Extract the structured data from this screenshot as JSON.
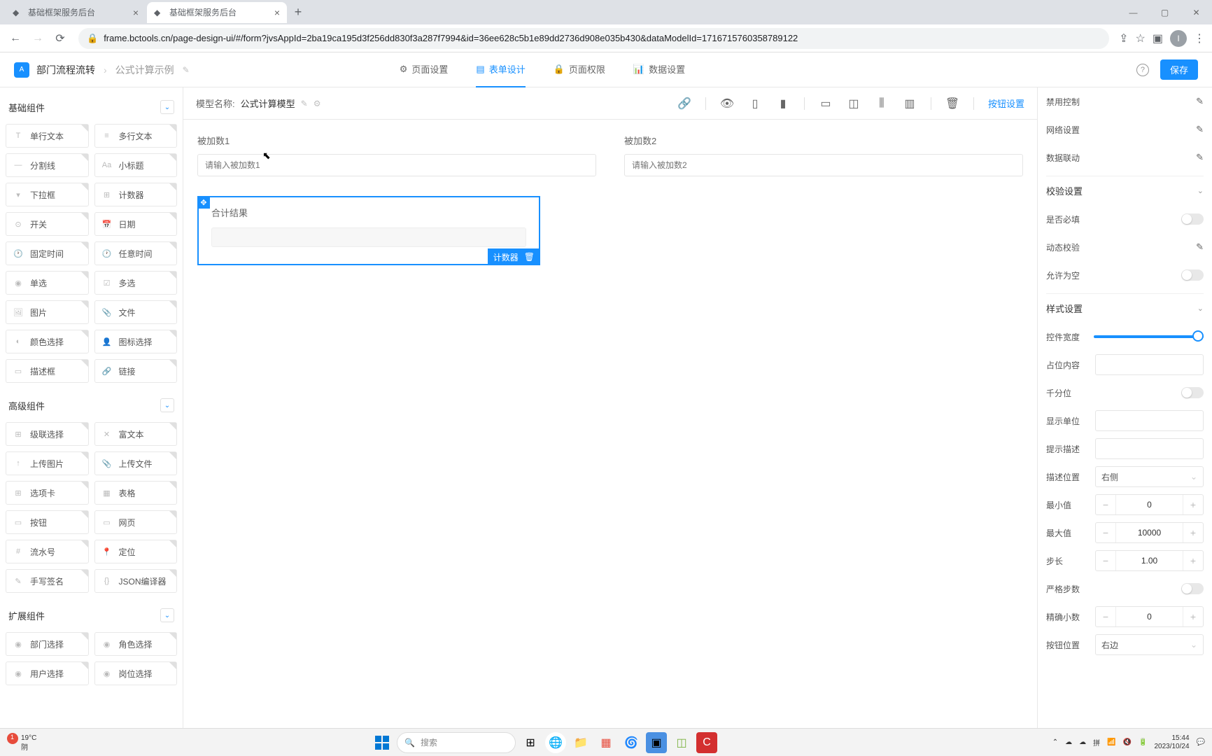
{
  "browser": {
    "tabs": [
      {
        "title": "基础框架服务后台",
        "active": false
      },
      {
        "title": "基础框架服务后台",
        "active": true
      }
    ],
    "url": "frame.bctools.cn/page-design-ui/#/form?jvsAppId=2ba19ca195d3f256dd830f3a287f7994&id=36ee628c5b1e89dd2736d908e035b430&dataModelId=1716715760358789122",
    "avatar": "I"
  },
  "header": {
    "breadcrumb": [
      "部门流程流转",
      "公式计算示例"
    ],
    "tabs": [
      {
        "icon": "page-icon",
        "label": "页面设置"
      },
      {
        "icon": "form-icon",
        "label": "表单设计",
        "active": true
      },
      {
        "icon": "perm-icon",
        "label": "页面权限"
      },
      {
        "icon": "data-icon",
        "label": "数据设置"
      }
    ],
    "save": "保存"
  },
  "leftPanel": {
    "basicTitle": "基础组件",
    "basic": [
      {
        "ic": "T",
        "label": "单行文本"
      },
      {
        "ic": "≡",
        "label": "多行文本"
      },
      {
        "ic": "—",
        "label": "分割线"
      },
      {
        "ic": "Aa",
        "label": "小标题"
      },
      {
        "ic": "▾",
        "label": "下拉框"
      },
      {
        "ic": "⊞",
        "label": "计数器"
      },
      {
        "ic": "⊙",
        "label": "开关"
      },
      {
        "ic": "📅",
        "label": "日期"
      },
      {
        "ic": "🕐",
        "label": "固定时间"
      },
      {
        "ic": "🕐",
        "label": "任意时间"
      },
      {
        "ic": "◉",
        "label": "单选"
      },
      {
        "ic": "☑",
        "label": "多选"
      },
      {
        "ic": "🖼",
        "label": "图片"
      },
      {
        "ic": "📎",
        "label": "文件"
      },
      {
        "ic": "◐",
        "label": "颜色选择"
      },
      {
        "ic": "👤",
        "label": "图标选择"
      },
      {
        "ic": "▭",
        "label": "描述框"
      },
      {
        "ic": "🔗",
        "label": "链接"
      }
    ],
    "advancedTitle": "高级组件",
    "advanced": [
      {
        "ic": "⊞",
        "label": "级联选择"
      },
      {
        "ic": "✕",
        "label": "富文本"
      },
      {
        "ic": "↑",
        "label": "上传图片"
      },
      {
        "ic": "📎",
        "label": "上传文件"
      },
      {
        "ic": "⊞",
        "label": "选项卡"
      },
      {
        "ic": "▦",
        "label": "表格"
      },
      {
        "ic": "▭",
        "label": "按钮"
      },
      {
        "ic": "▭",
        "label": "网页"
      },
      {
        "ic": "#",
        "label": "流水号"
      },
      {
        "ic": "📍",
        "label": "定位"
      },
      {
        "ic": "✎",
        "label": "手写签名"
      },
      {
        "ic": "{}",
        "label": "JSON编译器"
      }
    ],
    "extendTitle": "扩展组件",
    "extend": [
      {
        "ic": "◉",
        "label": "部门选择"
      },
      {
        "ic": "◉",
        "label": "角色选择"
      },
      {
        "ic": "◉",
        "label": "用户选择"
      },
      {
        "ic": "◉",
        "label": "岗位选择"
      }
    ]
  },
  "canvas": {
    "modelLabel": "模型名称:",
    "modelName": "公式计算模型",
    "buttonSettings": "按钮设置",
    "field1": {
      "label": "被加数1",
      "placeholder": "请输入被加数1"
    },
    "field2": {
      "label": "被加数2",
      "placeholder": "请输入被加数2"
    },
    "selectedField": {
      "label": "合计结果",
      "tag": "计数器"
    }
  },
  "rightPanel": {
    "rows1": [
      "禁用控制",
      "网络设置",
      "数据联动"
    ],
    "validateTitle": "校验设置",
    "validate": {
      "required": "是否必填",
      "dynamic": "动态校验",
      "allowEmpty": "允许为空"
    },
    "styleTitle": "样式设置",
    "style": {
      "width": "控件宽度",
      "placeholder": "占位内容",
      "thousand": "千分位",
      "unit": "显示单位",
      "tip": "提示描述",
      "descPos": {
        "label": "描述位置",
        "value": "右侧"
      },
      "min": {
        "label": "最小值",
        "value": "0"
      },
      "max": {
        "label": "最大值",
        "value": "10000"
      },
      "step": {
        "label": "步长",
        "value": "1.00"
      },
      "strictStep": "严格步数",
      "precision": {
        "label": "精确小数",
        "value": "0"
      },
      "btnPos": {
        "label": "按钮位置",
        "value": "右边"
      }
    }
  },
  "taskbar": {
    "temp": "19°C",
    "weather": "阴",
    "search": "搜索",
    "time": "15:44",
    "date": "2023/10/24"
  }
}
